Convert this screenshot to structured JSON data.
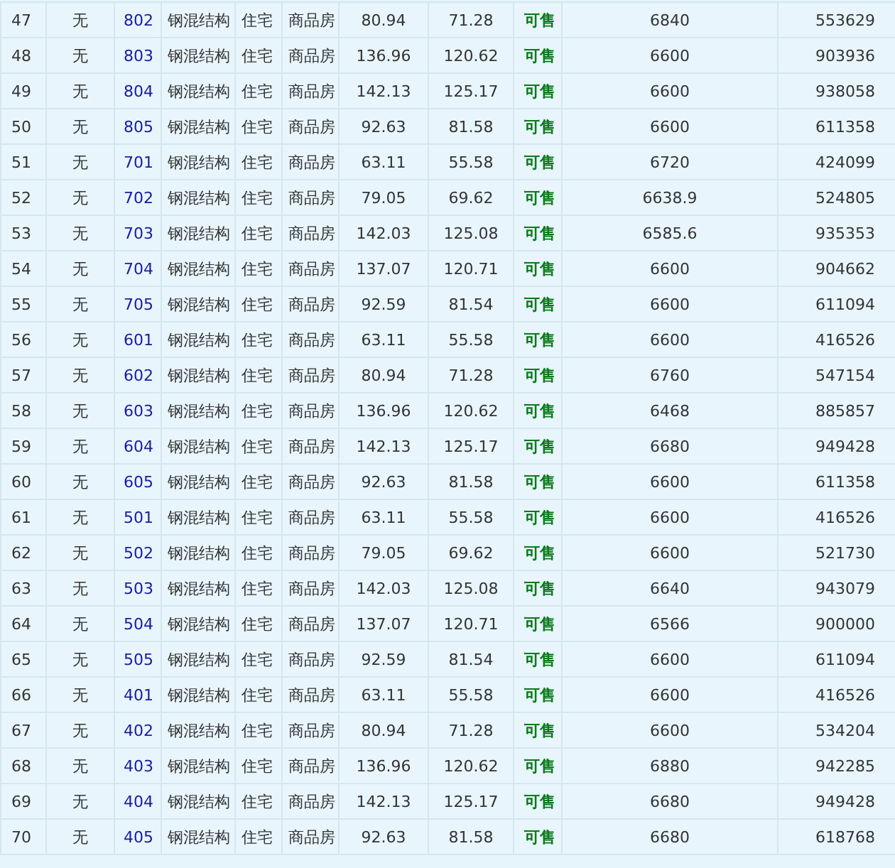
{
  "table": {
    "rows": [
      {
        "index": "47",
        "presale": "无",
        "room": "802",
        "structure": "钢混结构",
        "usage": "住宅",
        "property": "商品房",
        "area": "80.94",
        "inner_area": "71.28",
        "status": "可售",
        "unit_price": "6840",
        "total_price": "553629"
      },
      {
        "index": "48",
        "presale": "无",
        "room": "803",
        "structure": "钢混结构",
        "usage": "住宅",
        "property": "商品房",
        "area": "136.96",
        "inner_area": "120.62",
        "status": "可售",
        "unit_price": "6600",
        "total_price": "903936"
      },
      {
        "index": "49",
        "presale": "无",
        "room": "804",
        "structure": "钢混结构",
        "usage": "住宅",
        "property": "商品房",
        "area": "142.13",
        "inner_area": "125.17",
        "status": "可售",
        "unit_price": "6600",
        "total_price": "938058"
      },
      {
        "index": "50",
        "presale": "无",
        "room": "805",
        "structure": "钢混结构",
        "usage": "住宅",
        "property": "商品房",
        "area": "92.63",
        "inner_area": "81.58",
        "status": "可售",
        "unit_price": "6600",
        "total_price": "611358"
      },
      {
        "index": "51",
        "presale": "无",
        "room": "701",
        "structure": "钢混结构",
        "usage": "住宅",
        "property": "商品房",
        "area": "63.11",
        "inner_area": "55.58",
        "status": "可售",
        "unit_price": "6720",
        "total_price": "424099"
      },
      {
        "index": "52",
        "presale": "无",
        "room": "702",
        "structure": "钢混结构",
        "usage": "住宅",
        "property": "商品房",
        "area": "79.05",
        "inner_area": "69.62",
        "status": "可售",
        "unit_price": "6638.9",
        "total_price": "524805"
      },
      {
        "index": "53",
        "presale": "无",
        "room": "703",
        "structure": "钢混结构",
        "usage": "住宅",
        "property": "商品房",
        "area": "142.03",
        "inner_area": "125.08",
        "status": "可售",
        "unit_price": "6585.6",
        "total_price": "935353"
      },
      {
        "index": "54",
        "presale": "无",
        "room": "704",
        "structure": "钢混结构",
        "usage": "住宅",
        "property": "商品房",
        "area": "137.07",
        "inner_area": "120.71",
        "status": "可售",
        "unit_price": "6600",
        "total_price": "904662"
      },
      {
        "index": "55",
        "presale": "无",
        "room": "705",
        "structure": "钢混结构",
        "usage": "住宅",
        "property": "商品房",
        "area": "92.59",
        "inner_area": "81.54",
        "status": "可售",
        "unit_price": "6600",
        "total_price": "611094"
      },
      {
        "index": "56",
        "presale": "无",
        "room": "601",
        "structure": "钢混结构",
        "usage": "住宅",
        "property": "商品房",
        "area": "63.11",
        "inner_area": "55.58",
        "status": "可售",
        "unit_price": "6600",
        "total_price": "416526"
      },
      {
        "index": "57",
        "presale": "无",
        "room": "602",
        "structure": "钢混结构",
        "usage": "住宅",
        "property": "商品房",
        "area": "80.94",
        "inner_area": "71.28",
        "status": "可售",
        "unit_price": "6760",
        "total_price": "547154"
      },
      {
        "index": "58",
        "presale": "无",
        "room": "603",
        "structure": "钢混结构",
        "usage": "住宅",
        "property": "商品房",
        "area": "136.96",
        "inner_area": "120.62",
        "status": "可售",
        "unit_price": "6468",
        "total_price": "885857"
      },
      {
        "index": "59",
        "presale": "无",
        "room": "604",
        "structure": "钢混结构",
        "usage": "住宅",
        "property": "商品房",
        "area": "142.13",
        "inner_area": "125.17",
        "status": "可售",
        "unit_price": "6680",
        "total_price": "949428"
      },
      {
        "index": "60",
        "presale": "无",
        "room": "605",
        "structure": "钢混结构",
        "usage": "住宅",
        "property": "商品房",
        "area": "92.63",
        "inner_area": "81.58",
        "status": "可售",
        "unit_price": "6600",
        "total_price": "611358"
      },
      {
        "index": "61",
        "presale": "无",
        "room": "501",
        "structure": "钢混结构",
        "usage": "住宅",
        "property": "商品房",
        "area": "63.11",
        "inner_area": "55.58",
        "status": "可售",
        "unit_price": "6600",
        "total_price": "416526"
      },
      {
        "index": "62",
        "presale": "无",
        "room": "502",
        "structure": "钢混结构",
        "usage": "住宅",
        "property": "商品房",
        "area": "79.05",
        "inner_area": "69.62",
        "status": "可售",
        "unit_price": "6600",
        "total_price": "521730"
      },
      {
        "index": "63",
        "presale": "无",
        "room": "503",
        "structure": "钢混结构",
        "usage": "住宅",
        "property": "商品房",
        "area": "142.03",
        "inner_area": "125.08",
        "status": "可售",
        "unit_price": "6640",
        "total_price": "943079"
      },
      {
        "index": "64",
        "presale": "无",
        "room": "504",
        "structure": "钢混结构",
        "usage": "住宅",
        "property": "商品房",
        "area": "137.07",
        "inner_area": "120.71",
        "status": "可售",
        "unit_price": "6566",
        "total_price": "900000"
      },
      {
        "index": "65",
        "presale": "无",
        "room": "505",
        "structure": "钢混结构",
        "usage": "住宅",
        "property": "商品房",
        "area": "92.59",
        "inner_area": "81.54",
        "status": "可售",
        "unit_price": "6600",
        "total_price": "611094"
      },
      {
        "index": "66",
        "presale": "无",
        "room": "401",
        "structure": "钢混结构",
        "usage": "住宅",
        "property": "商品房",
        "area": "63.11",
        "inner_area": "55.58",
        "status": "可售",
        "unit_price": "6600",
        "total_price": "416526"
      },
      {
        "index": "67",
        "presale": "无",
        "room": "402",
        "structure": "钢混结构",
        "usage": "住宅",
        "property": "商品房",
        "area": "80.94",
        "inner_area": "71.28",
        "status": "可售",
        "unit_price": "6600",
        "total_price": "534204"
      },
      {
        "index": "68",
        "presale": "无",
        "room": "403",
        "structure": "钢混结构",
        "usage": "住宅",
        "property": "商品房",
        "area": "136.96",
        "inner_area": "120.62",
        "status": "可售",
        "unit_price": "6880",
        "total_price": "942285"
      },
      {
        "index": "69",
        "presale": "无",
        "room": "404",
        "structure": "钢混结构",
        "usage": "住宅",
        "property": "商品房",
        "area": "142.13",
        "inner_area": "125.17",
        "status": "可售",
        "unit_price": "6680",
        "total_price": "949428"
      },
      {
        "index": "70",
        "presale": "无",
        "room": "405",
        "structure": "钢混结构",
        "usage": "住宅",
        "property": "商品房",
        "area": "92.63",
        "inner_area": "81.58",
        "status": "可售",
        "unit_price": "6680",
        "total_price": "618768"
      }
    ]
  }
}
